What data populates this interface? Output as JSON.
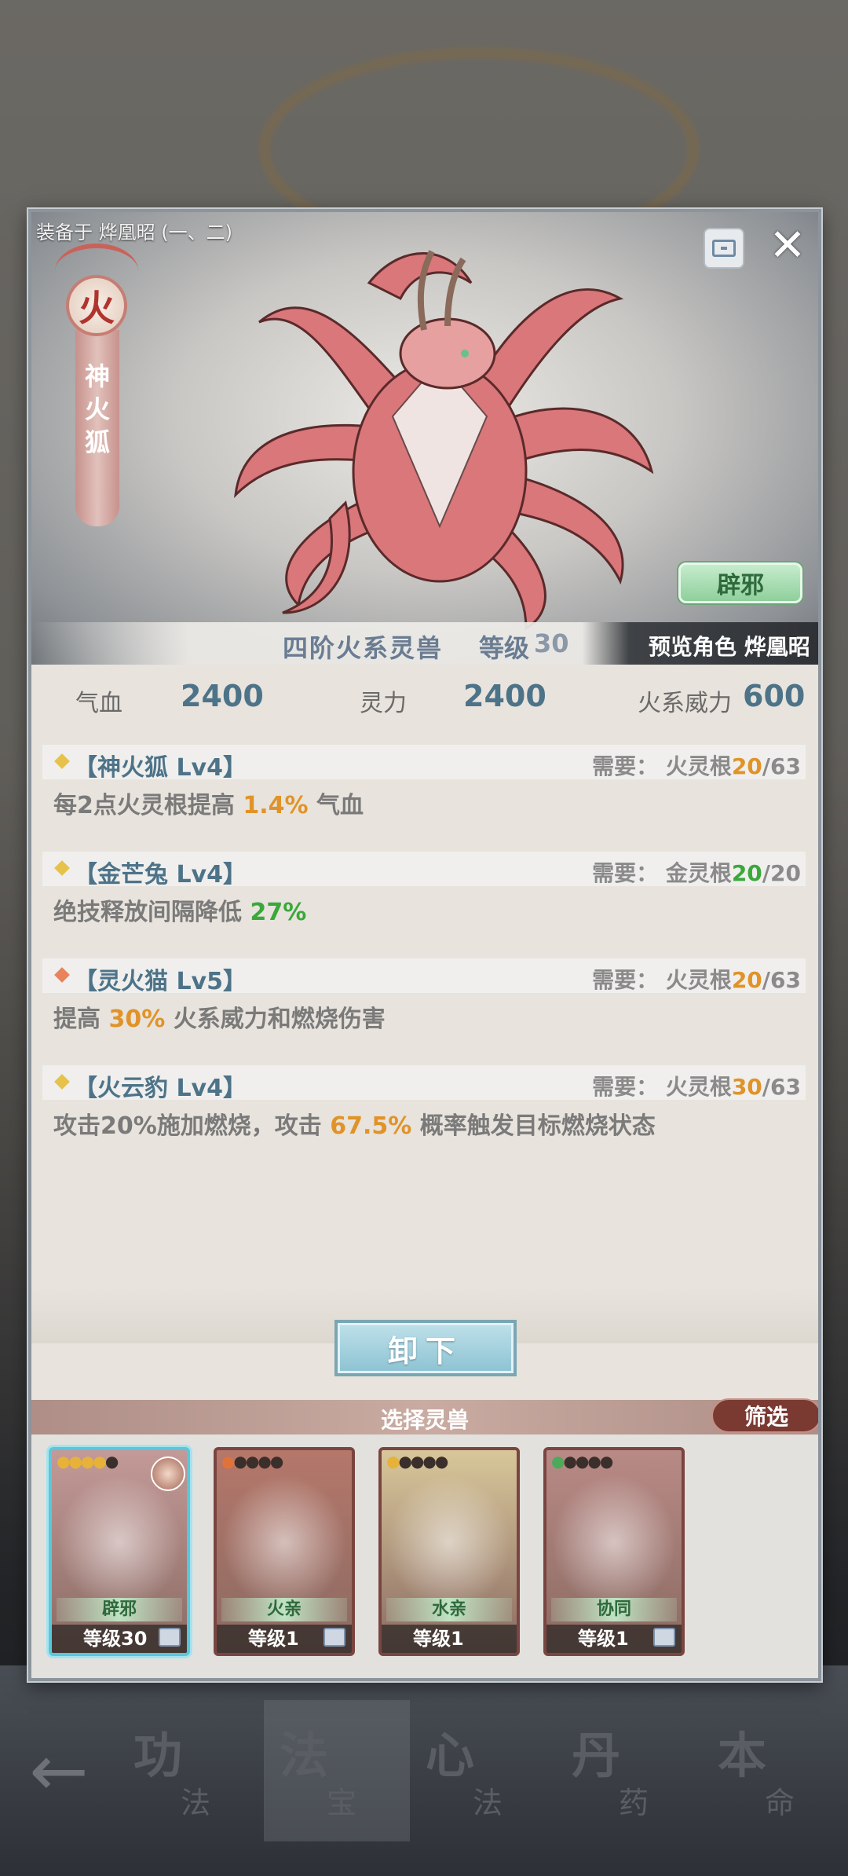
{
  "dialog": {
    "equipped_label": "装备于 烨凰昭 (一、二)",
    "element": "火",
    "beast_name_vertical": [
      "神",
      "火",
      "狐"
    ],
    "close_icon": "close-icon",
    "storage_icon": "storage-icon",
    "formation_button": "辟邪",
    "rank_text": "四阶火系灵兽",
    "level_label": "等级",
    "level_value": "30",
    "preview_role": "预览角色 烨凰昭",
    "stats": [
      {
        "label": "气血",
        "value": "2400"
      },
      {
        "label": "灵力",
        "value": "2400"
      },
      {
        "label": "火系威力",
        "value": "600"
      }
    ],
    "skills": [
      {
        "name": "【神火狐 Lv4】",
        "diamond_color": "#e7c24a",
        "req_prefix": "需要：  火灵根",
        "req_current": "20",
        "req_current_color": "#e09328",
        "req_max": "/63",
        "desc_before": "每2点火灵根提高 ",
        "desc_highlight": "1.4%",
        "highlight_color": "#e09328",
        "desc_after": " 气血"
      },
      {
        "name": "【金芒兔 Lv4】",
        "diamond_color": "#e7c24a",
        "req_prefix": "需要：  金灵根",
        "req_current": "20",
        "req_current_color": "#3aa83a",
        "req_max": "/20",
        "desc_before": "绝技释放间隔降低 ",
        "desc_highlight": "27%",
        "highlight_color": "#3aa83a",
        "desc_after": ""
      },
      {
        "name": "【灵火猫 Lv5】",
        "diamond_color": "#e8835c",
        "req_prefix": "需要：  火灵根",
        "req_current": "20",
        "req_current_color": "#e09328",
        "req_max": "/63",
        "desc_before": "提高 ",
        "desc_highlight": "30%",
        "highlight_color": "#e09328",
        "desc_after": " 火系威力和燃烧伤害"
      },
      {
        "name": "【火云豹 Lv4】",
        "diamond_color": "#e7c24a",
        "req_prefix": "需要：  火灵根",
        "req_current": "30",
        "req_current_color": "#e09328",
        "req_max": "/63",
        "desc_before": "攻击20%施加燃烧，攻击 ",
        "desc_highlight": "67.5%",
        "highlight_color": "#e09328",
        "desc_after": " 概率触发目标燃烧状态"
      }
    ],
    "unload_button": "卸下",
    "select_title": "选择灵兽",
    "filter_button": "筛选",
    "cards": [
      {
        "stars_on": 4,
        "stars_total": 5,
        "star_color": "gold",
        "form": "辟邪",
        "level": "等级30",
        "selected": true,
        "has_avatar": true,
        "has_storage": true,
        "bg": "#c39a98"
      },
      {
        "stars_on": 1,
        "stars_total": 5,
        "star_color": "orange",
        "form": "火亲",
        "level": "等级1",
        "selected": false,
        "has_avatar": false,
        "has_storage": true,
        "bg": "#b5776a"
      },
      {
        "stars_on": 1,
        "stars_total": 5,
        "star_color": "gold",
        "form": "水亲",
        "level": "等级1",
        "selected": false,
        "has_avatar": false,
        "has_storage": false,
        "bg": "#d8c79a"
      },
      {
        "stars_on": 1,
        "stars_total": 5,
        "star_color": "green",
        "form": "协同",
        "level": "等级1",
        "selected": false,
        "has_avatar": false,
        "has_storage": true,
        "bg": "#b98a86"
      }
    ]
  },
  "bottom_nav": {
    "back_icon": "back-arrow-icon",
    "tabs": [
      {
        "big": "功",
        "small": "法"
      },
      {
        "big": "法",
        "small": "宝"
      },
      {
        "big": "心",
        "small": "法"
      },
      {
        "big": "丹",
        "small": "药"
      },
      {
        "big": "本",
        "small": "命"
      }
    ]
  }
}
